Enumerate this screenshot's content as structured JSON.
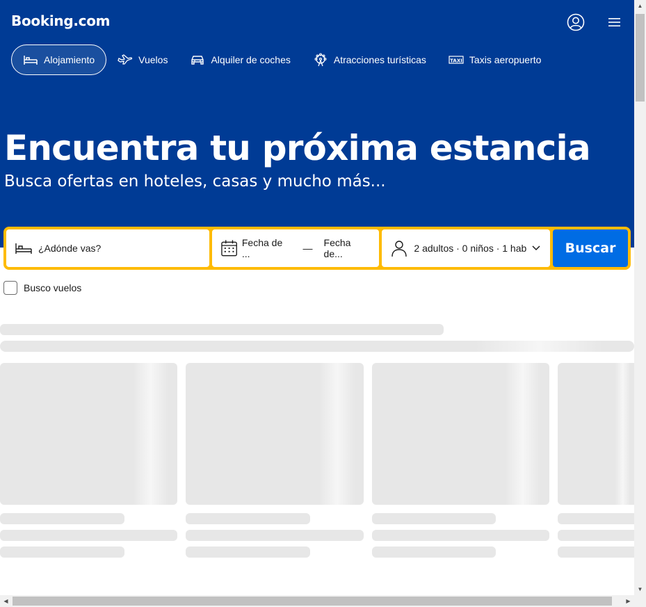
{
  "header": {
    "logo": "Booking.com",
    "account_icon": "account-circle-icon",
    "menu_icon": "hamburger-menu-icon"
  },
  "nav": {
    "items": [
      {
        "label": "Alojamiento",
        "icon": "bed-icon",
        "active": true
      },
      {
        "label": "Vuelos",
        "icon": "plane-icon",
        "active": false
      },
      {
        "label": "Alquiler de coches",
        "icon": "car-icon",
        "active": false
      },
      {
        "label": "Atracciones turísticas",
        "icon": "ferris-wheel-icon",
        "active": false
      },
      {
        "label": "Taxis aeropuerto",
        "icon": "taxi-icon",
        "active": false
      }
    ]
  },
  "hero": {
    "title": "Encuentra tu próxima estancia",
    "subtitle": "Busca ofertas en hoteles, casas y mucho más..."
  },
  "search": {
    "destination_placeholder": "¿Adónde vas?",
    "checkin_label": "Fecha de ...",
    "dash": "—",
    "checkout_label": "Fecha de...",
    "occupancy": "2 adultos · 0 niños · 1 hab",
    "button": "Buscar"
  },
  "flights_checkbox": {
    "label": "Busco vuelos",
    "checked": false
  },
  "colors": {
    "brand_blue": "#003b95",
    "search_border": "#febb02",
    "button_blue": "#006ce4",
    "skeleton": "#e7e7e7"
  }
}
